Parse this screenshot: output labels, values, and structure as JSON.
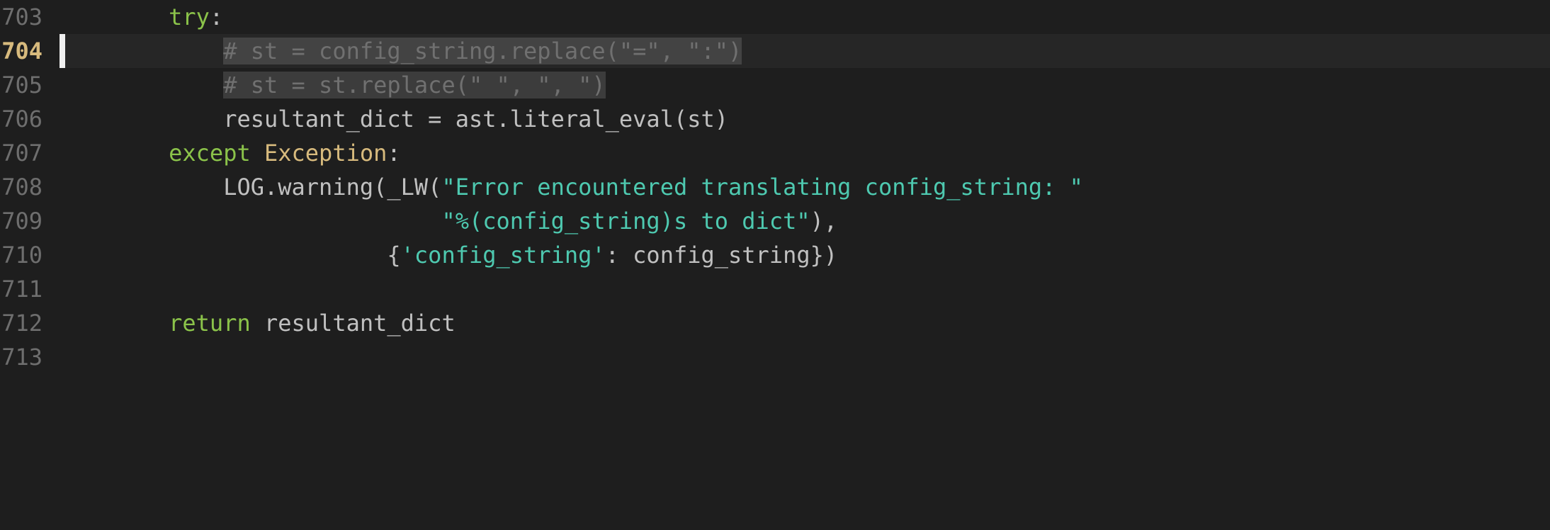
{
  "gutter": {
    "lines": [
      "703",
      "704",
      "705",
      "706",
      "707",
      "708",
      "709",
      "710",
      "711",
      "712",
      "713"
    ],
    "current_index": 1
  },
  "code": {
    "indent_unit": "    ",
    "rows": [
      {
        "indent": 2,
        "segments": [
          {
            "cls": "kw",
            "t": "try"
          },
          {
            "cls": "pun",
            "t": ":"
          }
        ]
      },
      {
        "indent": 3,
        "current": true,
        "cursor": true,
        "segments": [
          {
            "cls": "cmt sel",
            "t": "# st = config_string.replace(\"=\", \":\")"
          }
        ]
      },
      {
        "indent": 3,
        "segments": [
          {
            "cls": "cmt sel",
            "t": "# st = st.replace(\" \", \", \")"
          }
        ]
      },
      {
        "indent": 3,
        "segments": [
          {
            "cls": "id",
            "t": "resultant_dict "
          },
          {
            "cls": "pun",
            "t": "= "
          },
          {
            "cls": "id",
            "t": "ast"
          },
          {
            "cls": "pun",
            "t": "."
          },
          {
            "cls": "fn",
            "t": "literal_eval"
          },
          {
            "cls": "pun",
            "t": "("
          },
          {
            "cls": "id",
            "t": "st"
          },
          {
            "cls": "pun",
            "t": ")"
          }
        ]
      },
      {
        "indent": 2,
        "segments": [
          {
            "cls": "kw",
            "t": "except"
          },
          {
            "cls": "txt",
            "t": " "
          },
          {
            "cls": "cls",
            "t": "Exception"
          },
          {
            "cls": "pun",
            "t": ":"
          }
        ]
      },
      {
        "indent": 3,
        "segments": [
          {
            "cls": "id",
            "t": "LOG"
          },
          {
            "cls": "pun",
            "t": "."
          },
          {
            "cls": "fn",
            "t": "warning"
          },
          {
            "cls": "pun",
            "t": "("
          },
          {
            "cls": "fn",
            "t": "_LW"
          },
          {
            "cls": "pun",
            "t": "("
          },
          {
            "cls": "str",
            "t": "\"Error encountered translating config_string: \""
          }
        ]
      },
      {
        "indent": 3,
        "raw_prefix": "                ",
        "segments": [
          {
            "cls": "str",
            "t": "\"%(config_string)s to dict\""
          },
          {
            "cls": "pun",
            "t": "),"
          }
        ]
      },
      {
        "indent": 3,
        "raw_prefix": "            ",
        "segments": [
          {
            "cls": "pun",
            "t": "{"
          },
          {
            "cls": "str",
            "t": "'config_string'"
          },
          {
            "cls": "pun",
            "t": ": "
          },
          {
            "cls": "id",
            "t": "config_string"
          },
          {
            "cls": "pun",
            "t": "})"
          }
        ]
      },
      {
        "indent": 0,
        "segments": []
      },
      {
        "indent": 2,
        "segments": [
          {
            "cls": "kw",
            "t": "return"
          },
          {
            "cls": "txt",
            "t": " "
          },
          {
            "cls": "id",
            "t": "resultant_dict"
          }
        ]
      },
      {
        "indent": 0,
        "segments": []
      }
    ]
  }
}
